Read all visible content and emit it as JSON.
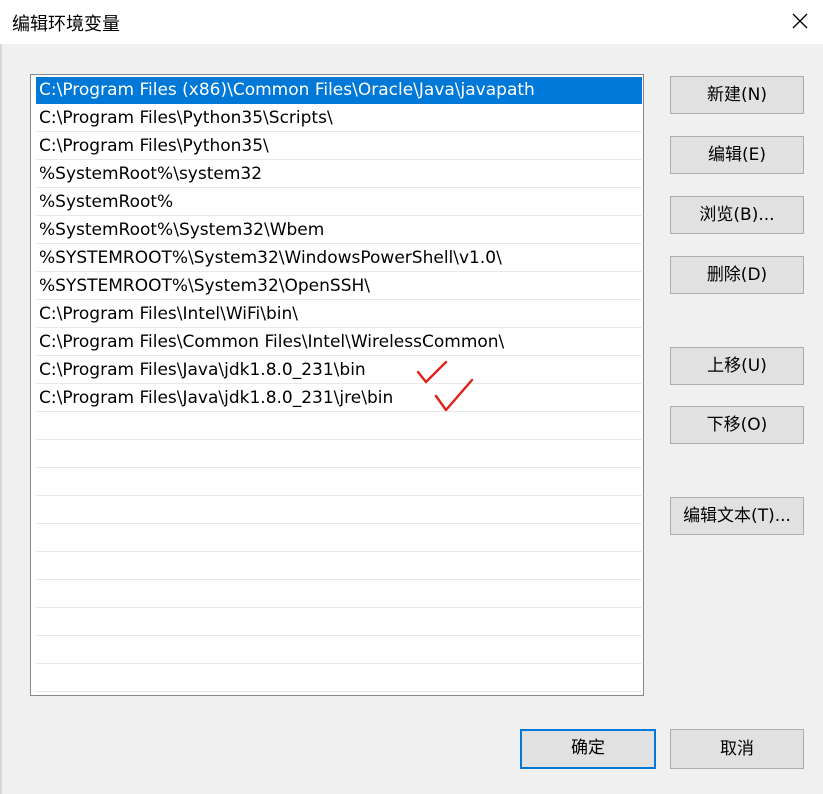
{
  "window": {
    "title": "编辑环境变量",
    "close_icon": "close-icon"
  },
  "paths": [
    "C:\\Program Files (x86)\\Common Files\\Oracle\\Java\\javapath",
    "C:\\Program Files\\Python35\\Scripts\\",
    "C:\\Program Files\\Python35\\",
    "%SystemRoot%\\system32",
    "%SystemRoot%",
    "%SystemRoot%\\System32\\Wbem",
    "%SYSTEMROOT%\\System32\\WindowsPowerShell\\v1.0\\",
    "%SYSTEMROOT%\\System32\\OpenSSH\\",
    "C:\\Program Files\\Intel\\WiFi\\bin\\",
    "C:\\Program Files\\Common Files\\Intel\\WirelessCommon\\",
    "C:\\Program Files\\Java\\jdk1.8.0_231\\bin",
    "C:\\Program Files\\Java\\jdk1.8.0_231\\jre\\bin"
  ],
  "selected_index": 0,
  "annotations": {
    "checkmark_color": "#e0201a"
  },
  "buttons": {
    "new": "新建(N)",
    "edit": "编辑(E)",
    "browse": "浏览(B)...",
    "delete": "删除(D)",
    "move_up": "上移(U)",
    "move_down": "下移(O)",
    "edit_text": "编辑文本(T)...",
    "ok": "确定",
    "cancel": "取消"
  },
  "colors": {
    "selection": "#0078d7",
    "default_button_border": "#0078d7"
  }
}
